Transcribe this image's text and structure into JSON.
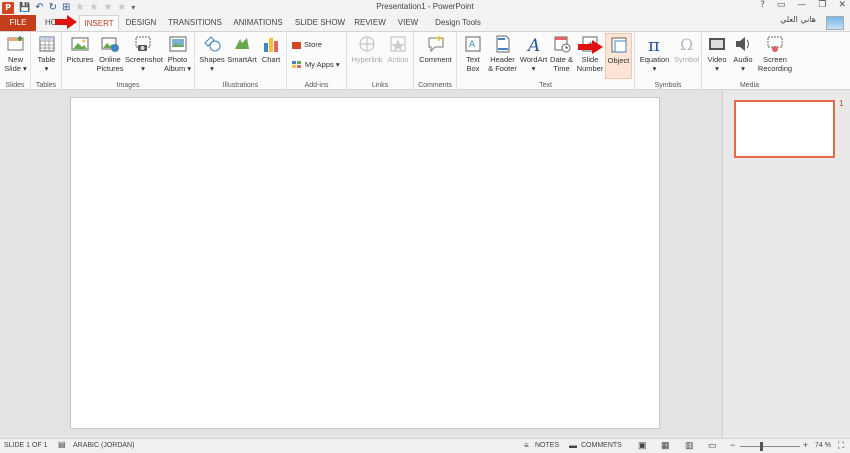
{
  "window": {
    "title": "Presentation1 - PowerPoint",
    "controls": [
      "?",
      "▭",
      "—",
      "❐",
      "✕"
    ]
  },
  "qat": {
    "app_letter": "P",
    "save": "💾",
    "undo": "↶",
    "redo": "↻",
    "custom": "⊞",
    "stars": [
      "★",
      "★",
      "★",
      "★"
    ],
    "more": "▾"
  },
  "tabs": [
    {
      "label": "FILE"
    },
    {
      "label": "HOME"
    },
    {
      "label": "INSERT"
    },
    {
      "label": "DESIGN"
    },
    {
      "label": "TRANSITIONS"
    },
    {
      "label": "ANIMATIONS"
    },
    {
      "label": "SLIDE SHOW"
    },
    {
      "label": "REVIEW"
    },
    {
      "label": "VIEW"
    },
    {
      "label": "Design Tools"
    }
  ],
  "user": {
    "name": "هاني العلي"
  },
  "ribbon": {
    "groups": [
      {
        "label": "Slides",
        "buttons": [
          {
            "label": "New\nSlide ▾"
          }
        ]
      },
      {
        "label": "Tables",
        "buttons": [
          {
            "label": "Table\n▾"
          }
        ]
      },
      {
        "label": "Images",
        "buttons": [
          {
            "label": "Pictures"
          },
          {
            "label": "Online\nPictures"
          },
          {
            "label": "Screenshot\n▾"
          },
          {
            "label": "Photo\nAlbum ▾"
          }
        ]
      },
      {
        "label": "Illustrations",
        "buttons": [
          {
            "label": "Shapes\n▾"
          },
          {
            "label": "SmartArt"
          },
          {
            "label": "Chart"
          }
        ]
      },
      {
        "label": "Add-ins",
        "buttons": [
          {
            "label": "Store"
          },
          {
            "label": "My Apps ▾"
          }
        ]
      },
      {
        "label": "Links",
        "buttons": [
          {
            "label": "Hyperlink"
          },
          {
            "label": "Action"
          }
        ]
      },
      {
        "label": "Comments",
        "buttons": [
          {
            "label": "Comment"
          }
        ]
      },
      {
        "label": "Text",
        "buttons": [
          {
            "label": "Text\nBox"
          },
          {
            "label": "Header\n& Footer"
          },
          {
            "label": "WordArt\n▾"
          },
          {
            "label": "Date &\nTime"
          },
          {
            "label": "Slide\nNumber"
          },
          {
            "label": "Object"
          }
        ]
      },
      {
        "label": "Symbols",
        "buttons": [
          {
            "label": "Equation\n▾"
          },
          {
            "label": "Symbol"
          }
        ]
      },
      {
        "label": "Media",
        "buttons": [
          {
            "label": "Video\n▾"
          },
          {
            "label": "Audio\n▾"
          },
          {
            "label": "Screen\nRecording"
          }
        ]
      }
    ]
  },
  "thumbnails": [
    {
      "number": "1"
    }
  ],
  "status": {
    "slide": "SLIDE 1 OF 1",
    "language": "ARABIC (JORDAN)",
    "notes": "NOTES",
    "comments": "COMMENTS",
    "zoom": "74 %"
  },
  "colors": {
    "accent": "#c43e1c",
    "arrow": "#e01010",
    "thumb_border": "#e66a43"
  }
}
